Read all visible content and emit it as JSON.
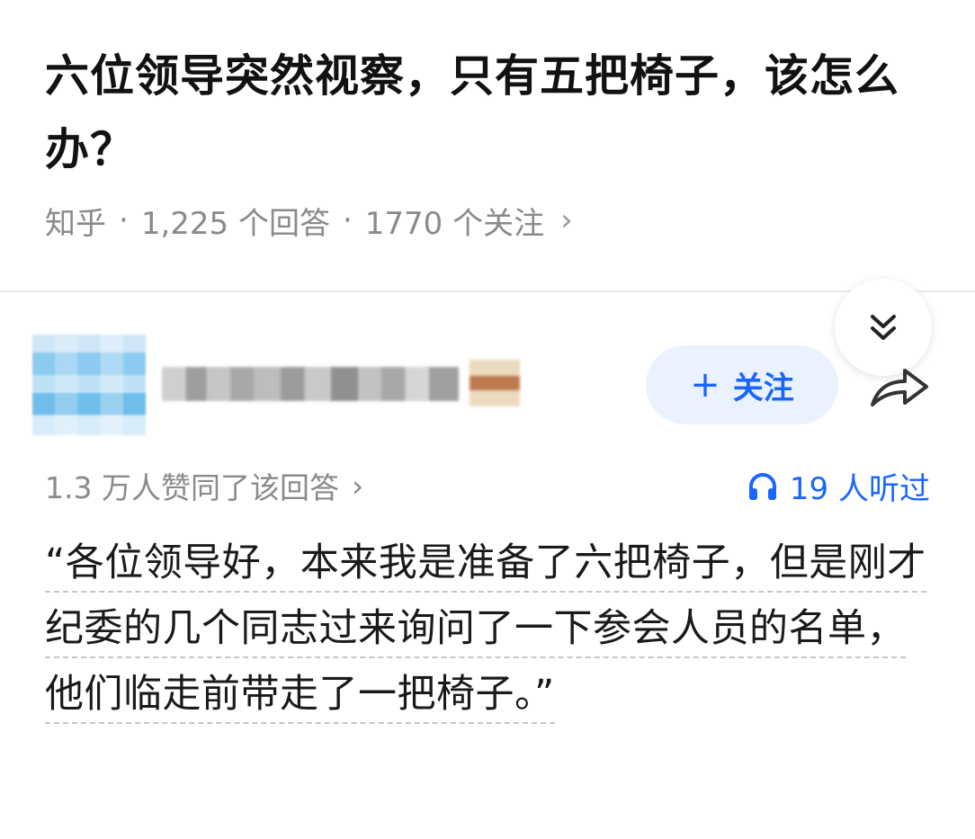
{
  "question": {
    "title": "六位领导突然视察，只有五把椅子，该怎么办？"
  },
  "meta": {
    "source": "知乎",
    "separator": "·",
    "answers": "1,225 个回答",
    "followers": "1770 个关注",
    "chevron": "›"
  },
  "author": {
    "follow_plus": "+",
    "follow_label": "关注"
  },
  "answer": {
    "upvotes": "1.3 万人赞同了该回答",
    "upvotes_chevron": "›",
    "listens": "19 人听过",
    "text": "“各位领导好，本来我是准备了六把椅子，但是刚才纪委的几个同志过来询问了一下参会人员的名单，他们临走前带走了一把椅子。”"
  },
  "icons": {
    "collapse": "double-chevron-down-icon",
    "share": "share-arrow-icon",
    "listen": "headphones-icon"
  },
  "colors": {
    "accent": "#1a66ff",
    "follow_bg": "#eaf2ff",
    "meta_text": "#8a8a8a"
  }
}
